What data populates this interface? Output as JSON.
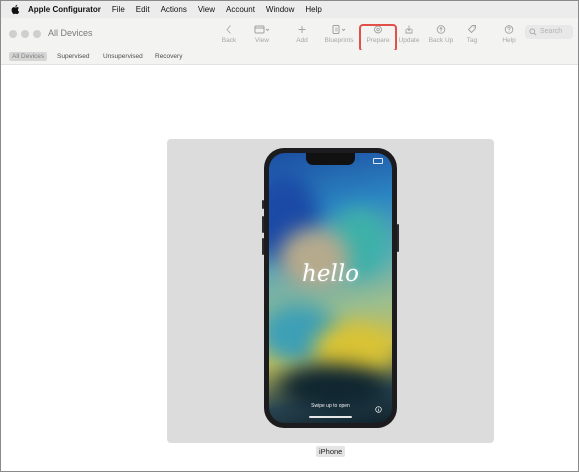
{
  "menubar": {
    "app_name": "Apple Configurator",
    "items": [
      "File",
      "Edit",
      "Actions",
      "View",
      "Account",
      "Window",
      "Help"
    ]
  },
  "window": {
    "title": "All Devices"
  },
  "toolbar": {
    "buttons": [
      {
        "label": "Back",
        "icon": "chevron-left-icon"
      },
      {
        "label": "View",
        "icon": "view-window-icon"
      },
      {
        "label": "Add",
        "icon": "plus-icon"
      },
      {
        "label": "Blueprints",
        "icon": "blueprints-icon"
      },
      {
        "label": "Prepare",
        "icon": "gear-icon"
      },
      {
        "label": "Update",
        "icon": "update-icon"
      },
      {
        "label": "Back Up",
        "icon": "backup-icon"
      },
      {
        "label": "Tag",
        "icon": "tag-icon"
      },
      {
        "label": "Help",
        "icon": "help-icon"
      }
    ],
    "highlighted": "Prepare",
    "search_placeholder": "Search"
  },
  "filters": {
    "items": [
      "All Devices",
      "Supervised",
      "Unsupervised",
      "Recovery"
    ],
    "active": "All Devices"
  },
  "device": {
    "name": "iPhone",
    "lock_screen_text": "hello",
    "swipe_hint": "Swipe up to open"
  },
  "colors": {
    "highlight": "#e2504a",
    "tile_background": "#dcdcdc",
    "toolbar_background": "#f3f3f2"
  }
}
